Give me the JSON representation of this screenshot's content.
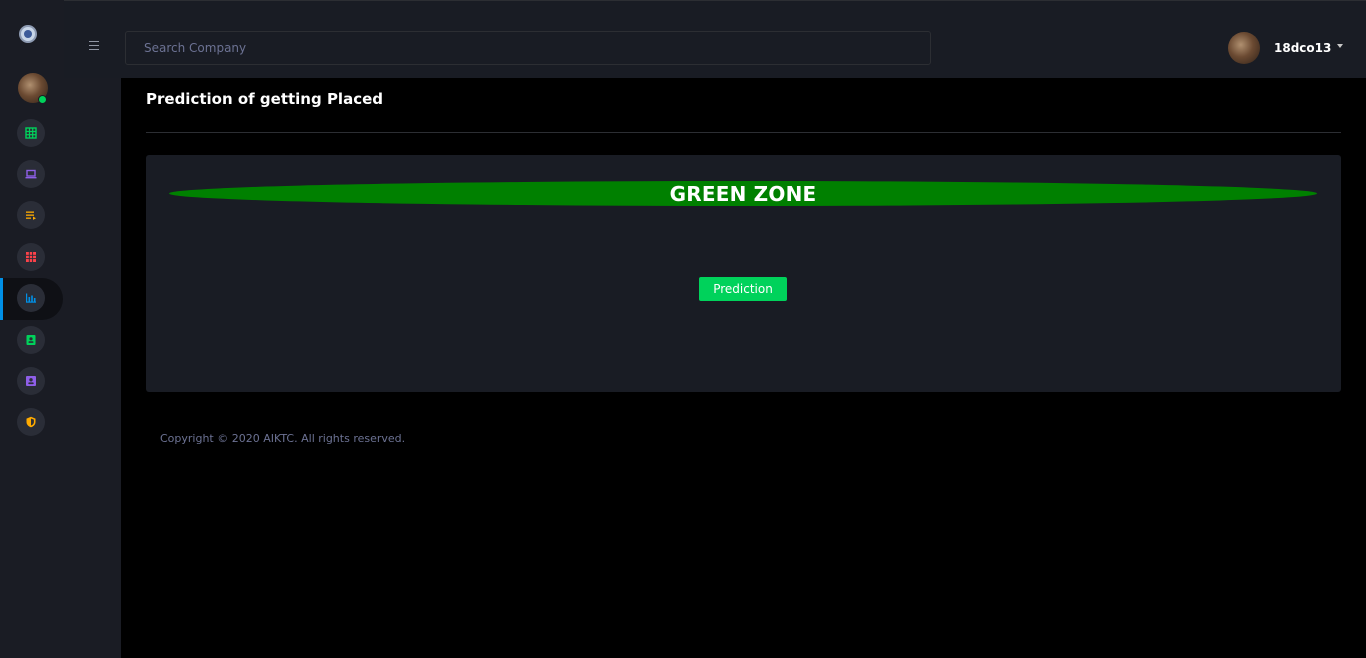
{
  "search": {
    "placeholder": "Search Company"
  },
  "profile": {
    "username": "18dco13"
  },
  "sidebar": {
    "items": [
      {
        "icon": "table-icon",
        "color": "#00d25b"
      },
      {
        "icon": "laptop-icon",
        "color": "#8f5fe8"
      },
      {
        "icon": "playlist-icon",
        "color": "#ffab00"
      },
      {
        "icon": "table-large-icon",
        "color": "#fc424a"
      },
      {
        "icon": "chart-bar-icon",
        "color": "#0090e7",
        "active": true
      },
      {
        "icon": "contacts-icon",
        "color": "#00d25b"
      },
      {
        "icon": "account-box-icon",
        "color": "#8f5fe8"
      },
      {
        "icon": "security-icon",
        "color": "#ffab00"
      }
    ]
  },
  "page": {
    "title": "Prediction of getting Placed"
  },
  "result": {
    "zone_label": "GREEN ZONE",
    "zone_color": "#008000"
  },
  "actions": {
    "prediction_label": "Prediction"
  },
  "footer": {
    "copyright": "Copyright © 2020 AIKTC. All rights reserved."
  }
}
